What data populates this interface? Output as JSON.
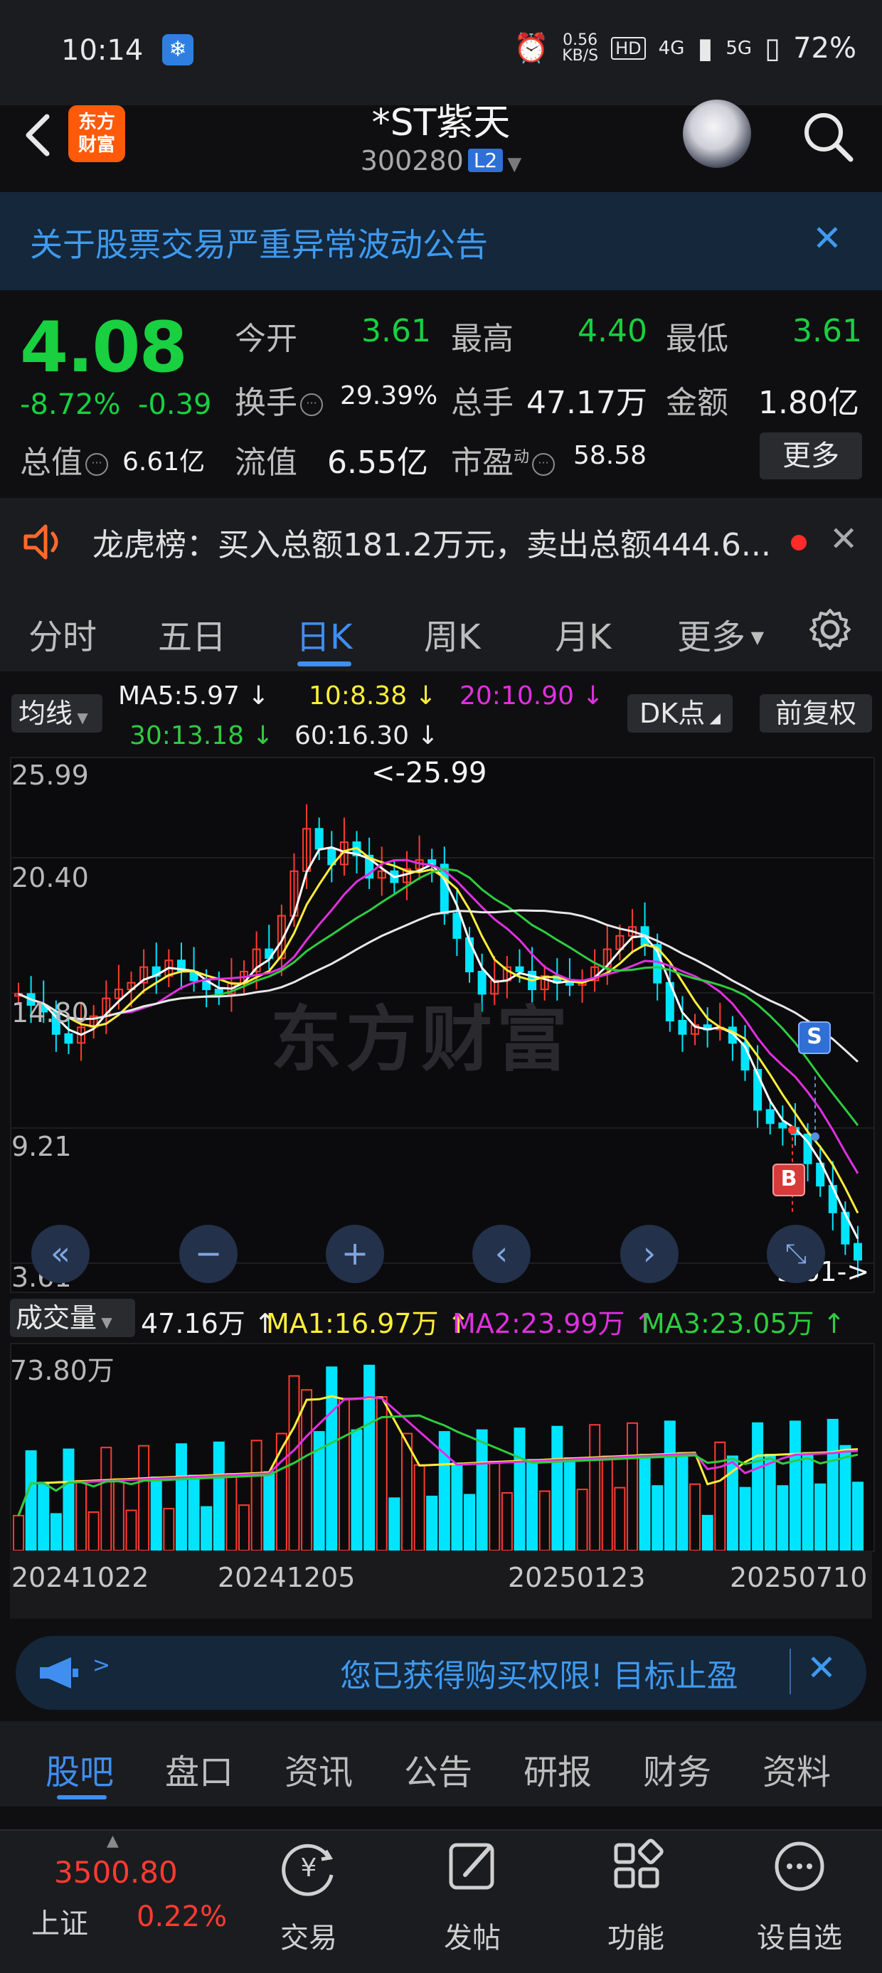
{
  "status_bar": {
    "time": "10:14",
    "net_speed": "0.56",
    "net_unit": "KB/S",
    "hd": "HD",
    "g1": "4G",
    "g2": "5G",
    "battery": "72%"
  },
  "header": {
    "logo_line1": "东方",
    "logo_line2": "财富",
    "name": "*ST紫天",
    "code": "300280",
    "level": "L2"
  },
  "notice": {
    "text": "关于股票交易严重异常波动公告",
    "close": "✕"
  },
  "quote": {
    "price": "4.08",
    "change_pct": "-8.72%",
    "change_val": "-0.39",
    "open_label": "今开",
    "open": "3.61",
    "high_label": "最高",
    "high": "4.40",
    "low_label": "最低",
    "low": "3.61",
    "turnover_label": "换手",
    "turnover": "29.39%",
    "volume_label": "总手",
    "volume": "47.17万",
    "amount_label": "金额",
    "amount": "1.80亿",
    "mktcap_label": "总值",
    "mktcap": "6.61亿",
    "float_label": "流值",
    "float": "6.55亿",
    "pe_label": "市盈",
    "pe_sup": "动",
    "pe": "58.58",
    "more": "更多"
  },
  "dragon_tiger": {
    "text": "龙虎榜：买入总额181.2万元，卖出总额444.6...",
    "close": "✕"
  },
  "tabs": [
    "分时",
    "五日",
    "日K",
    "周K",
    "月K",
    "更多"
  ],
  "chart_header": {
    "selector": "均线",
    "ma5": "MA5:5.97",
    "ma10": "10:8.38",
    "ma20": "20:10.90",
    "ma30": "30:13.18",
    "ma60": "60:16.30",
    "dk": "DK点",
    "fq": "前复权"
  },
  "kchart": {
    "y_labels": [
      "25.99",
      "20.40",
      "14.80",
      "9.21",
      "3.61"
    ],
    "high_label": "<-25.99",
    "low_label": "3.61->",
    "watermark": "东方财富",
    "sell_marker": "S",
    "buy_marker": "B",
    "colors": {
      "up": "#ff3b30",
      "down": "#00e5ff",
      "ma5": "#ffffff",
      "ma10": "#ffef3a",
      "ma20": "#e030e0",
      "ma30": "#2ecc40",
      "ma60": "#e8e8e8"
    }
  },
  "volume": {
    "selector": "成交量",
    "vol": "47.16万",
    "ma1": "MA1:16.97万",
    "ma2": "MA2:23.99万",
    "ma3": "MA3:23.05万",
    "max_label": "73.80万",
    "dates": [
      "20241022",
      "20241205",
      "20250123",
      "20250710"
    ]
  },
  "promo": {
    "text": "您已获得购买权限! 目标止盈",
    "close": "✕"
  },
  "sub_tabs": [
    "股吧",
    "盘口",
    "资讯",
    "公告",
    "研报",
    "财务",
    "资料"
  ],
  "bottom_nav": {
    "index_value": "3500.80",
    "index_name": "上证",
    "index_pct": "0.22%",
    "items": [
      "交易",
      "发帖",
      "功能",
      "设自选"
    ]
  }
}
